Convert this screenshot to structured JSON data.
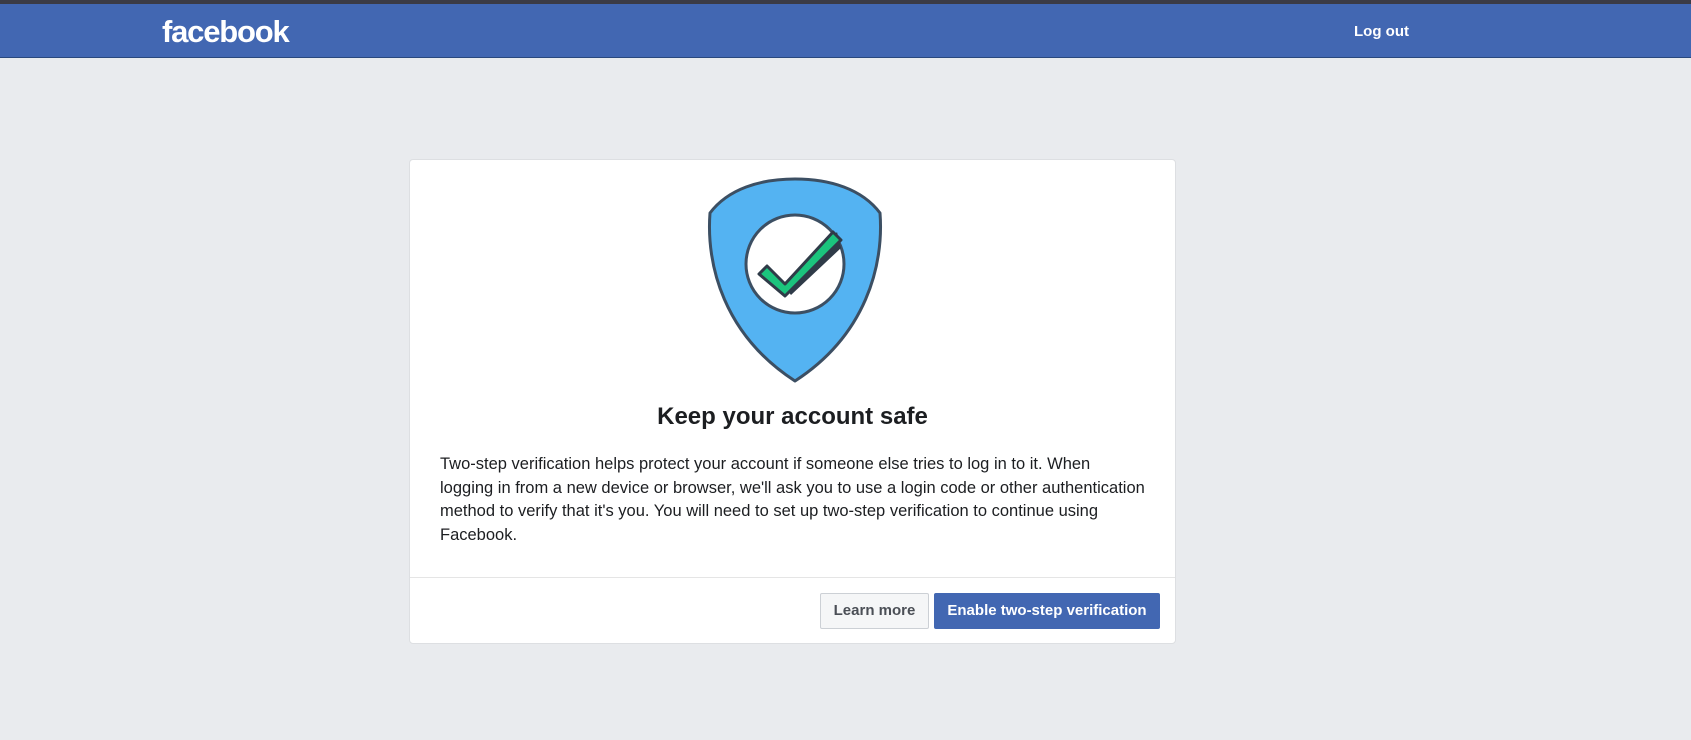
{
  "header": {
    "logo_text": "facebook",
    "logout_label": "Log out",
    "background_color": "#4267b2"
  },
  "card": {
    "illustration_icon": "shield-check-icon",
    "title": "Keep your account safe",
    "description": "Two-step verification helps protect your account if someone else tries to log in to it. When logging in from a new device or browser, we'll ask you to use a login code or other authentication method to verify that it's you. You will need to set up two-step verification to continue using Facebook.",
    "learn_more_label": "Learn more",
    "enable_label": "Enable two-step verification"
  },
  "colors": {
    "page_background": "#e9ebee",
    "shield": "#54b3f2",
    "checkmark": "#1bc47d",
    "primary_button": "#4267b2"
  }
}
